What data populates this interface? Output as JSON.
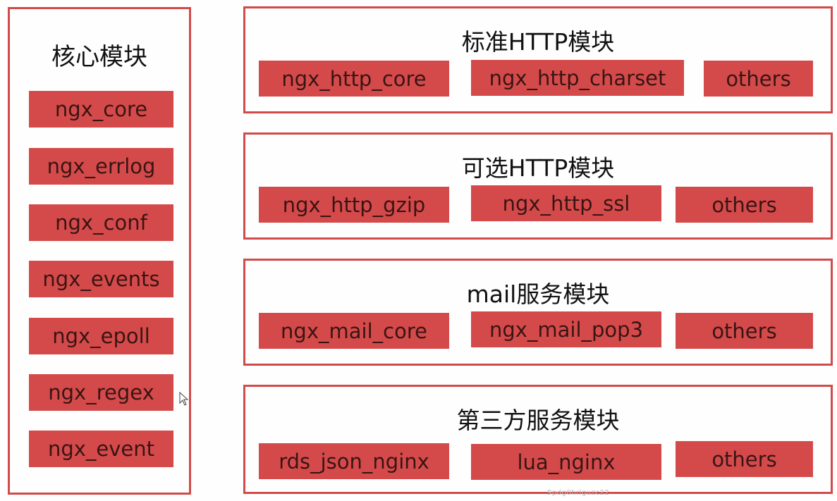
{
  "core_panel": {
    "title": "核心模块",
    "modules": [
      "ngx_core",
      "ngx_errlog",
      "ngx_conf",
      "ngx_events",
      "ngx_epoll",
      "ngx_regex",
      "ngx_event"
    ]
  },
  "groups": [
    {
      "title": "标准HTTP模块",
      "modules": [
        "ngx_http_core",
        "ngx_http_charset",
        "others"
      ]
    },
    {
      "title": "可选HTTP模块",
      "modules": [
        "ngx_http_gzip",
        "ngx_http_ssl",
        "others"
      ]
    },
    {
      "title": "mail服务模块",
      "modules": [
        "ngx_mail_core",
        "ngx_mail_pop3",
        "others"
      ]
    },
    {
      "title": "第三方服务模块",
      "modules": [
        "rds_json_nginx",
        "lua_nginx",
        "others"
      ]
    }
  ],
  "colors": {
    "accent": "#d44a4a",
    "border": "#d24a4a",
    "text": "#111111"
  },
  "watermark": "9pdg0hrlguzc22"
}
